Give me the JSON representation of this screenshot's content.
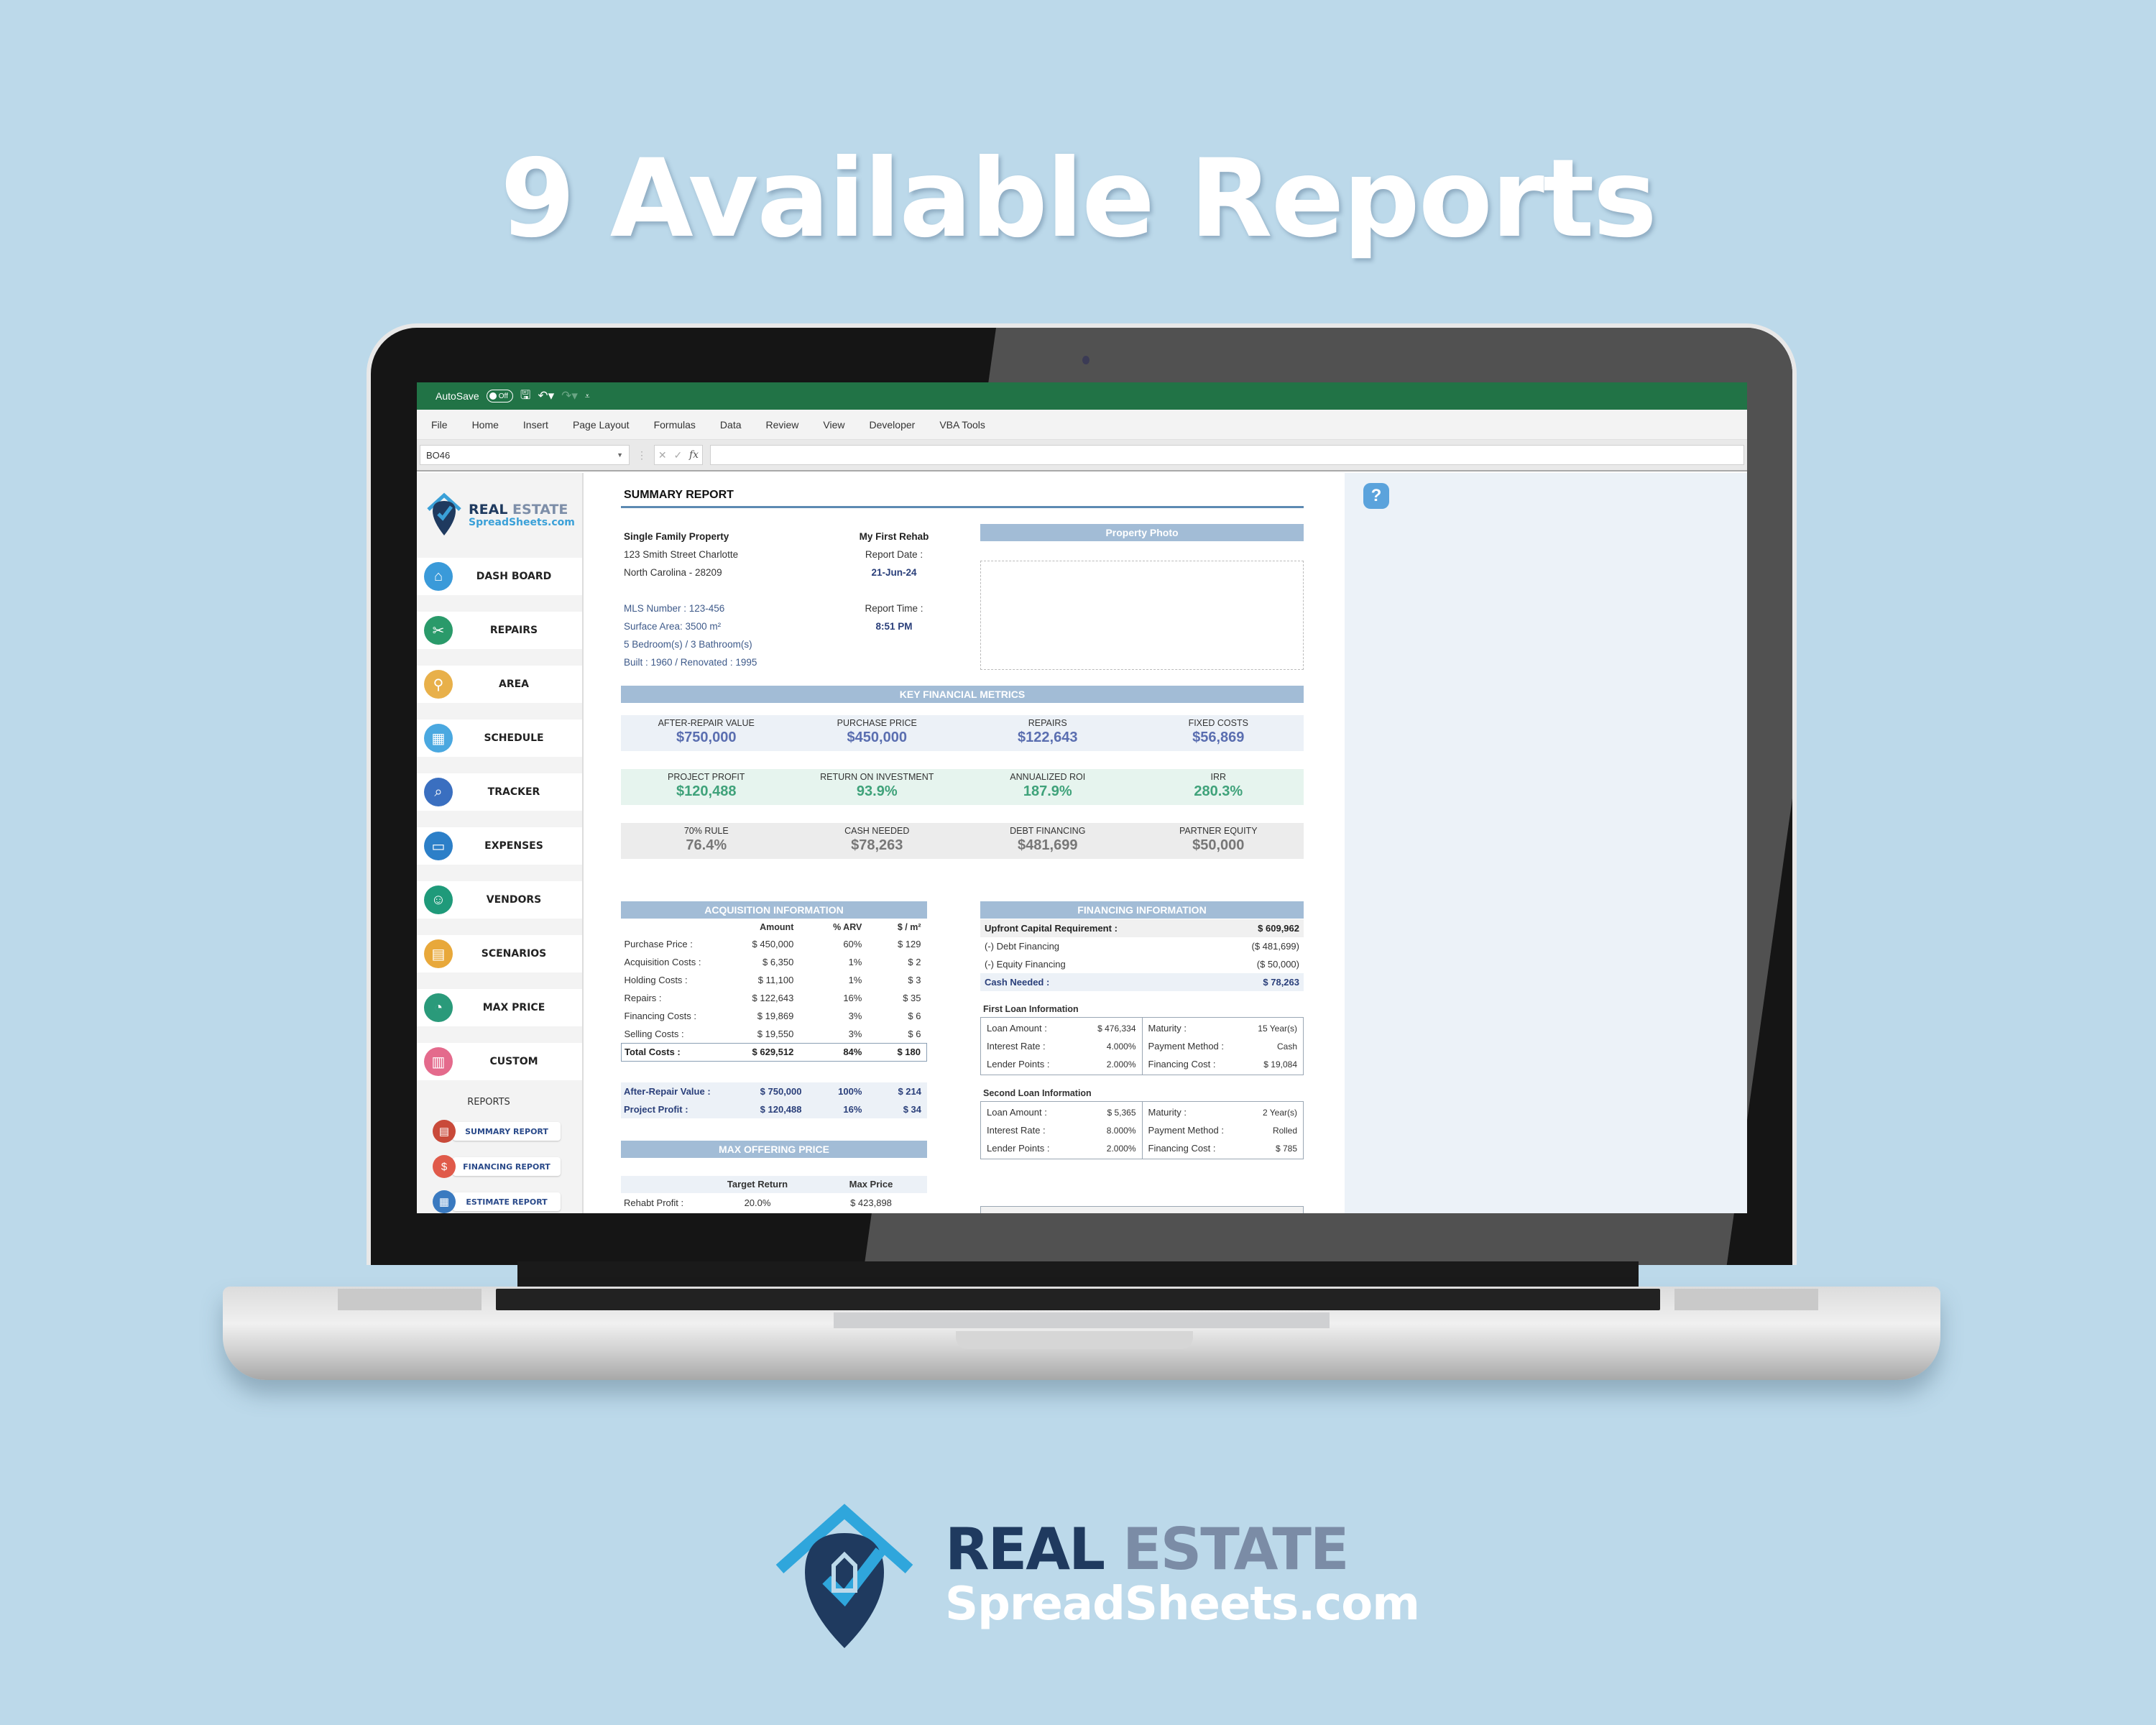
{
  "headline": "9 Available Reports",
  "excel": {
    "titlebar": {
      "autosave_label": "AutoSave",
      "autosave_state": "Off"
    },
    "menu": [
      "File",
      "Home",
      "Insert",
      "Page Layout",
      "Formulas",
      "Data",
      "Review",
      "View",
      "Developer",
      "VBA Tools"
    ],
    "name_box": "BO46",
    "formula": ""
  },
  "sidebar": {
    "logo": {
      "line1a": "REAL",
      "line1b": "ESTATE",
      "line2": "SpreadSheets.com"
    },
    "items": [
      {
        "label": "DASH BOARD",
        "icon": "house-icon",
        "color": "#3a9ad9",
        "glyph": "⌂"
      },
      {
        "label": "REPAIRS",
        "icon": "wrench-icon",
        "color": "#2a9a6a",
        "glyph": "✂"
      },
      {
        "label": "AREA",
        "icon": "map-pin-icon",
        "color": "#e8b04a",
        "glyph": "⚲"
      },
      {
        "label": "SCHEDULE",
        "icon": "calendar-icon",
        "color": "#4aa8e0",
        "glyph": "▦"
      },
      {
        "label": "TRACKER",
        "icon": "search-chart-icon",
        "color": "#3a6fc0",
        "glyph": "⌕"
      },
      {
        "label": "EXPENSES",
        "icon": "monitor-icon",
        "color": "#2c7fc8",
        "glyph": "▭"
      },
      {
        "label": "VENDORS",
        "icon": "support-agent-icon",
        "color": "#1f9a7a",
        "glyph": "☺"
      },
      {
        "label": "SCENARIOS",
        "icon": "scenario-icon",
        "color": "#e8a83a",
        "glyph": "▤"
      },
      {
        "label": "MAX PRICE",
        "icon": "gauge-icon",
        "color": "#2a9a7a",
        "glyph": "◔"
      },
      {
        "label": "CUSTOM",
        "icon": "custom-sheet-icon",
        "color": "#e46a8c",
        "glyph": "▥"
      }
    ],
    "reports_title": "REPORTS",
    "reports": [
      {
        "label": "SUMMARY REPORT",
        "icon": "summary-report-icon",
        "color": "#c94a3a",
        "glyph": "▤"
      },
      {
        "label": "FINANCING REPORT",
        "icon": "financing-report-icon",
        "color": "#e05a4a",
        "glyph": "$"
      },
      {
        "label": "ESTIMATE REPORT",
        "icon": "estimate-report-icon",
        "color": "#3a7ac0",
        "glyph": "▦"
      }
    ]
  },
  "report": {
    "title": "SUMMARY REPORT",
    "property": {
      "type": "Single Family Property",
      "address1": "123 Smith Street Charlotte",
      "address2": "North Carolina - 28209",
      "mls": "MLS Number : 123-456",
      "surface": "Surface Area: 3500 m²",
      "rooms": "5 Bedroom(s) / 3 Bathroom(s)",
      "built": "Built : 1960 / Renovated : 1995"
    },
    "meta": {
      "project_name": "My First Rehab",
      "date_label": "Report Date :",
      "date": "21-Jun-24",
      "time_label": "Report Time :",
      "time": "8:51 PM"
    },
    "photo_title": "Property Photo",
    "metrics_title": "KEY FINANCIAL METRICS",
    "metrics": [
      [
        {
          "label": "AFTER-REPAIR VALUE",
          "value": "$750,000"
        },
        {
          "label": "PURCHASE PRICE",
          "value": "$450,000"
        },
        {
          "label": "REPAIRS",
          "value": "$122,643"
        },
        {
          "label": "FIXED COSTS",
          "value": "$56,869"
        }
      ],
      [
        {
          "label": "PROJECT PROFIT",
          "value": "$120,488"
        },
        {
          "label": "RETURN ON INVESTMENT",
          "value": "93.9%"
        },
        {
          "label": "ANNUALIZED ROI",
          "value": "187.9%"
        },
        {
          "label": "IRR",
          "value": "280.3%"
        }
      ],
      [
        {
          "label": "70% RULE",
          "value": "76.4%"
        },
        {
          "label": "CASH NEEDED",
          "value": "$78,263"
        },
        {
          "label": "DEBT FINANCING",
          "value": "$481,699"
        },
        {
          "label": "PARTNER EQUITY",
          "value": "$50,000"
        }
      ]
    ],
    "acquisition": {
      "title": "ACQUISITION INFORMATION",
      "headers": [
        "",
        "Amount",
        "% ARV",
        "$ / m²"
      ],
      "rows": [
        [
          "Purchase Price :",
          "$ 450,000",
          "60%",
          "$ 129"
        ],
        [
          "Acquisition Costs :",
          "$ 6,350",
          "1%",
          "$ 2"
        ],
        [
          "Holding Costs :",
          "$ 11,100",
          "1%",
          "$ 3"
        ],
        [
          "Repairs :",
          "$ 122,643",
          "16%",
          "$ 35"
        ],
        [
          "Financing Costs :",
          "$ 19,869",
          "3%",
          "$ 6"
        ],
        [
          "Selling Costs :",
          "$ 19,550",
          "3%",
          "$ 6"
        ]
      ],
      "total": [
        "Total Costs :",
        "$ 629,512",
        "84%",
        "$ 180"
      ],
      "summary": [
        [
          "After-Repair Value :",
          "$ 750,000",
          "100%",
          "$ 214"
        ],
        [
          "Project Profit :",
          "$ 120,488",
          "16%",
          "$ 34"
        ]
      ]
    },
    "max_offer": {
      "title": "MAX OFFERING PRICE",
      "headers": [
        "",
        "Target Return",
        "Max Price"
      ],
      "rows": [
        [
          "Rehabt Profit :",
          "20.0%",
          "$ 423,898"
        ]
      ]
    },
    "financing": {
      "title": "FINANCING INFORMATION",
      "upfront_label": "Upfront Capital Requirement :",
      "upfront_value": "$ 609,962",
      "debt_label": "(-) Debt Financing",
      "debt_value": "($ 481,699)",
      "equity_label": "(-) Equity Financing",
      "equity_value": "($ 50,000)",
      "cash_label": "Cash Needed :",
      "cash_value": "$ 78,263",
      "loans": [
        {
          "title": "First Loan Information",
          "left": [
            [
              "Loan Amount :",
              "$ 476,334"
            ],
            [
              "Interest Rate :",
              "4.000%"
            ],
            [
              "Lender Points :",
              "2.000%"
            ]
          ],
          "right": [
            [
              "Maturity :",
              "15 Year(s)"
            ],
            [
              "Payment Method :",
              "Cash"
            ],
            [
              "Financing Cost :",
              "$ 19,084"
            ]
          ]
        },
        {
          "title": "Second  Loan Information",
          "left": [
            [
              "Loan Amount :",
              "$ 5,365"
            ],
            [
              "Interest Rate :",
              "8.000%"
            ],
            [
              "Lender Points :",
              "2.000%"
            ]
          ],
          "right": [
            [
              "Maturity :",
              "2 Year(s)"
            ],
            [
              "Payment Method :",
              "Rolled"
            ],
            [
              "Financing Cost :",
              "$ 785"
            ]
          ]
        }
      ]
    }
  },
  "brand": {
    "line1a": "REAL",
    "line1b": "ESTATE",
    "line2": "SpreadSheets.com"
  }
}
